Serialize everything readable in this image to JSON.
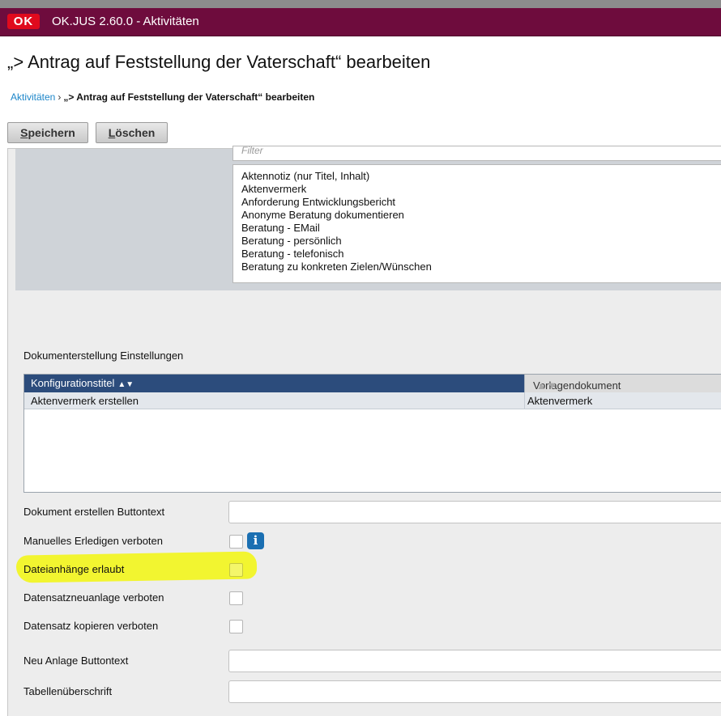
{
  "app": {
    "logo": "OK",
    "title": "OK.JUS 2.60.0 - Aktivitäten"
  },
  "page": {
    "title": "„> Antrag auf Feststellung der Vaterschaft“ bearbeiten"
  },
  "breadcrumb": {
    "link": "Aktivitäten",
    "separator": "›",
    "current": "„> Antrag auf Feststellung der Vaterschaft“ bearbeiten"
  },
  "toolbar": {
    "save_first": "S",
    "save_rest": "peichern",
    "delete_first": "L",
    "delete_rest": "öschen"
  },
  "filter": {
    "placeholder": "Filter"
  },
  "templates_list": [
    "Aktennotiz (nur Titel, Inhalt)",
    "Aktenvermerk",
    "Anforderung Entwicklungsbericht",
    "Anonyme Beratung dokumentieren",
    "Beratung - EMail",
    "Beratung - persönlich",
    "Beratung - telefonisch",
    "Beratung zu konkreten Zielen/Wünschen"
  ],
  "doc_settings": {
    "title": "Dokumenterstellung Einstellungen",
    "columns": [
      "Konfigurationstitel",
      "Vorlagendokument"
    ],
    "rows": [
      [
        "Aktenvermerk erstellen",
        "Aktenvermerk"
      ]
    ]
  },
  "fields": {
    "doc_button_text": {
      "label": "Dokument erstellen Buttontext",
      "value": ""
    },
    "manual_done_forbidden": {
      "label": "Manuelles Erledigen verboten",
      "checked": false
    },
    "attachments_allowed": {
      "label": "Dateianhänge erlaubt",
      "checked": false,
      "highlight_color": "#f2f526"
    },
    "new_record_forbidden": {
      "label": "Datensatzneuanlage verboten",
      "checked": false
    },
    "copy_record_forbidden": {
      "label": "Datensatz kopieren verboten",
      "checked": false
    },
    "new_entry_button_text": {
      "label": "Neu Anlage Buttontext",
      "value": ""
    },
    "table_heading": {
      "label": "Tabellenüberschrift",
      "value": ""
    }
  },
  "icons": {
    "info": "info-icon",
    "sort": "sort-arrows-icon"
  },
  "colors": {
    "titlebar": "#6e0c3d",
    "logo": "#e00a1d",
    "grid_header": "#2c4c7c",
    "link": "#1d86c9"
  }
}
